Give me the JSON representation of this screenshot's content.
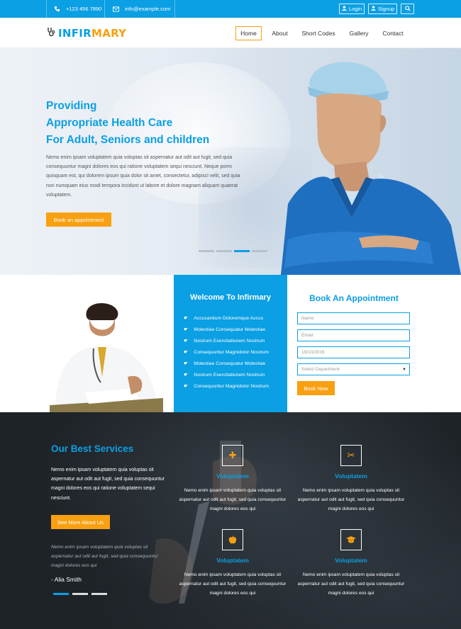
{
  "topbar": {
    "phone": "+123 456 7890",
    "email": "info@example.com",
    "login": "Login",
    "signup": "Signup"
  },
  "brand": {
    "logo_part1": "INFIR",
    "logo_part2": "MARY"
  },
  "nav": [
    "Home",
    "About",
    "Short Codes",
    "Gallery",
    "Contact"
  ],
  "hero": {
    "heading1": "Providing",
    "heading2": "Appropriate Health Care",
    "heading3": "For Adult, Seniors and children",
    "paragraph": "Nemo enim ipsam voluptatem quia voluptas sit aspernatur aut odit aut fugit, sed quia consequuntur magni dolores eos qui ratione voluptatem sequi nesciunt. Neque porro quisquam est, qui dolorem ipsum quia dolor sit amet, consectetur, adipisci velit, sed quia non numquam eius modi tempora incidunt ut labore et dolore magnam aliquam quaerat voluptatem.",
    "cta": "Book an appointment"
  },
  "welcome": {
    "title": "Welcome To Infirmary",
    "items": [
      "Accusantium Doloremque Accus",
      "Molestiae Consequatur Molestiae",
      "Nostrum Exercitationem Nostrum",
      "Consequuntur Magnidolor Nostrum",
      "Molestiae Consequatur Molestiae",
      "Nostrum Exercitationem Nostrum",
      "Consequuntur Magnidolor Nostrum"
    ]
  },
  "appointment": {
    "title": "Book An Appointment",
    "name_placeholder": "Name",
    "email_placeholder": "Email",
    "date_value": "19/10/2016",
    "department_value": "Select Department",
    "submit": "Book Now"
  },
  "services": {
    "title": "Our Best Services",
    "intro": "Nemo enim ipsam voluptatem quia voluptas sit aspernatur aut odit aut fugit, sed quia consequuntur magni dolores eos qui ratione voluptatem sequi nesciunt.",
    "cta": "See More About Us",
    "quote": "Nemo enim ipsam voluptatem quia voluptas sit aspernatur aut odit aut fugit, sed quia consequuntur magni dolores eos qui",
    "author": "- Alia Smith",
    "items": [
      {
        "icon": "plus-icon",
        "title": "Voluptatem",
        "text": "Nemo enim ipsam voluptatem quia voluptas sit aspernatur aut odit aut fugit, sed quia consequuntur magni dolores eos qui"
      },
      {
        "icon": "scissors-icon",
        "title": "Voluptatem",
        "text": "Nemo enim ipsam voluptatem quia voluptas sit aspernatur aut odit aut fugit, sed quia consequuntur magni dolores eos qui"
      },
      {
        "icon": "apple-icon",
        "title": "Voluptatem",
        "text": "Nemo enim ipsam voluptatem quia voluptas sit aspernatur aut odit aut fugit, sed quia consequuntur magni dolores eos qui"
      },
      {
        "icon": "graduation-cap-icon",
        "title": "Voluptatem",
        "text": "Nemo enim ipsam voluptatem quia voluptas sit aspernatur aut odit aut fugit, sed quia consequuntur magni dolores eos qui"
      }
    ]
  },
  "colors": {
    "primary": "#0b9fe3",
    "accent": "#f8a011",
    "dark": "#1e2328"
  }
}
